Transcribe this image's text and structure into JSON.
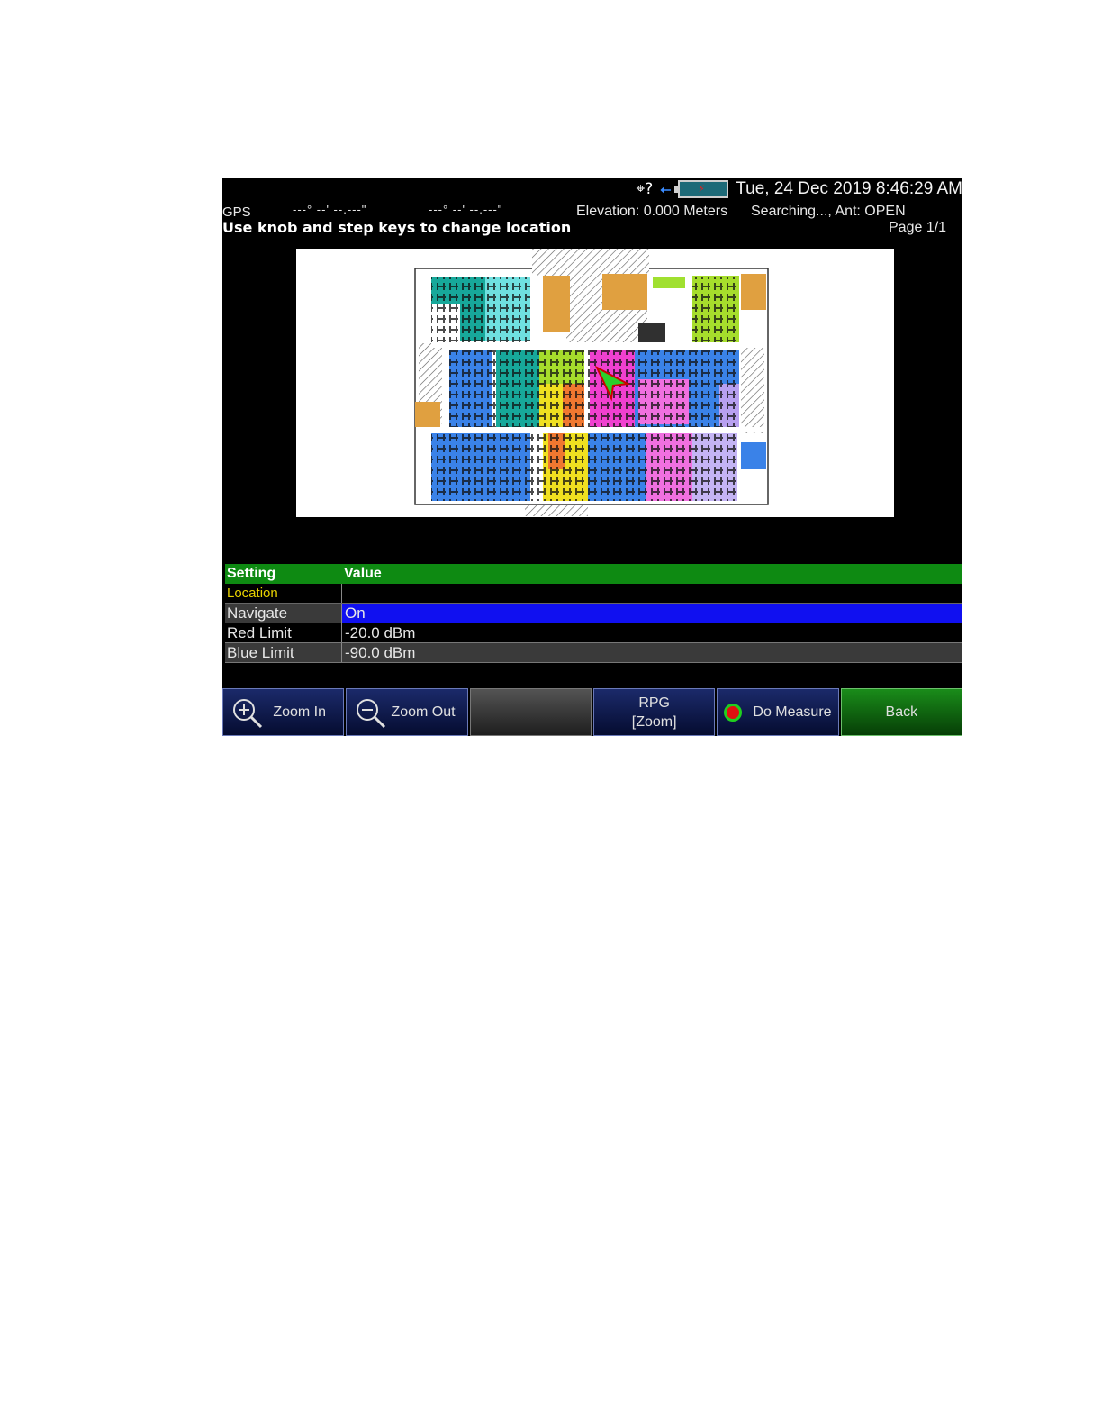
{
  "status_bar": {
    "gps_icon": "crosshair-icon",
    "gps_icon_text": "⌖?",
    "usb_icon": "usb-icon",
    "battery_icon": "battery-icon",
    "datetime": "Tue, 24 Dec 2019 8:46:29 AM"
  },
  "gps": {
    "label": "GPS",
    "latitude": "---° --' --.---\"",
    "longitude": "---° --' --.---\"",
    "elevation": "Elevation: 0.000 Meters",
    "status": "Searching..., Ant: OPEN"
  },
  "instruction": "Use knob and step keys to change location",
  "page_indicator": "Page 1/1",
  "settings_table": {
    "headers": {
      "setting": "Setting",
      "value": "Value"
    },
    "rows": [
      {
        "setting": "Location",
        "value": ""
      },
      {
        "setting": "Navigate",
        "value": "On"
      },
      {
        "setting": "Red Limit",
        "value": "-20.0 dBm"
      },
      {
        "setting": "Blue Limit",
        "value": "-90.0 dBm"
      }
    ]
  },
  "softkeys": {
    "zoom_in": "Zoom In",
    "zoom_out": "Zoom Out",
    "empty": "",
    "rpg_line1": "RPG",
    "rpg_line2": "[Zoom]",
    "do_measure": "Do Measure",
    "back": "Back"
  },
  "colors": {
    "header_green": "#0e8a12",
    "selected_blue": "#1010f0",
    "location_yellow": "#e8d200"
  }
}
